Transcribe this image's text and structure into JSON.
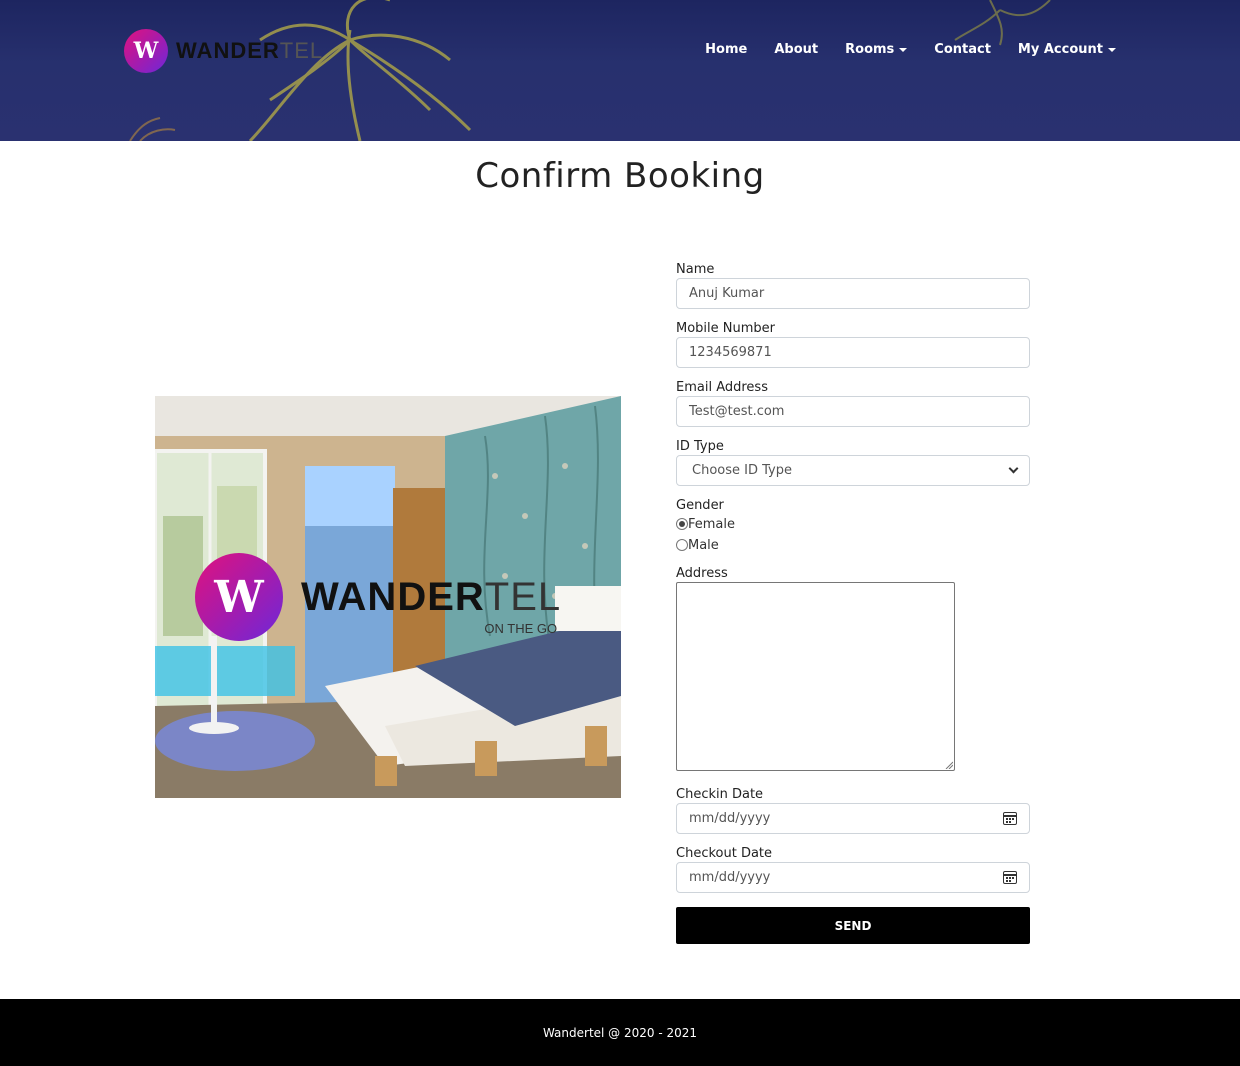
{
  "brand": {
    "badge_letter": "W",
    "name_bold": "WANDER",
    "name_light": "TEL",
    "tagline": "ON THE GO",
    "colors": {
      "gradient_start": "#e0127d",
      "gradient_end": "#6d28d9"
    }
  },
  "nav": {
    "items": [
      {
        "label": "Home",
        "dropdown": false
      },
      {
        "label": "About",
        "dropdown": false
      },
      {
        "label": "Rooms",
        "dropdown": true
      },
      {
        "label": "Contact",
        "dropdown": false
      },
      {
        "label": "My Account",
        "dropdown": true
      }
    ]
  },
  "page": {
    "title": "Confirm Booking"
  },
  "form": {
    "name": {
      "label": "Name",
      "value": "Anuj Kumar"
    },
    "mobile": {
      "label": "Mobile Number",
      "value": "1234569871"
    },
    "email": {
      "label": "Email Address",
      "value": "Test@test.com"
    },
    "id_type": {
      "label": "ID Type",
      "selected": "Choose ID Type"
    },
    "gender": {
      "label": "Gender",
      "options": [
        {
          "label": "Female",
          "checked": true
        },
        {
          "label": "Male",
          "checked": false
        }
      ]
    },
    "address": {
      "label": "Address",
      "value": ""
    },
    "checkin": {
      "label": "Checkin Date",
      "placeholder": "mm/dd/yyyy"
    },
    "checkout": {
      "label": "Checkout Date",
      "placeholder": "mm/dd/yyyy"
    },
    "submit_label": "SEND"
  },
  "footer": {
    "text": "Wandertel @ 2020 - 2021"
  },
  "icons": {
    "calendar": "calendar-icon",
    "caret": "caret-down-icon",
    "select": "chevron-down-icon"
  },
  "theme": {
    "header_bg": "#1d2560",
    "footer_bg": "#000000",
    "button_bg": "#000000"
  }
}
